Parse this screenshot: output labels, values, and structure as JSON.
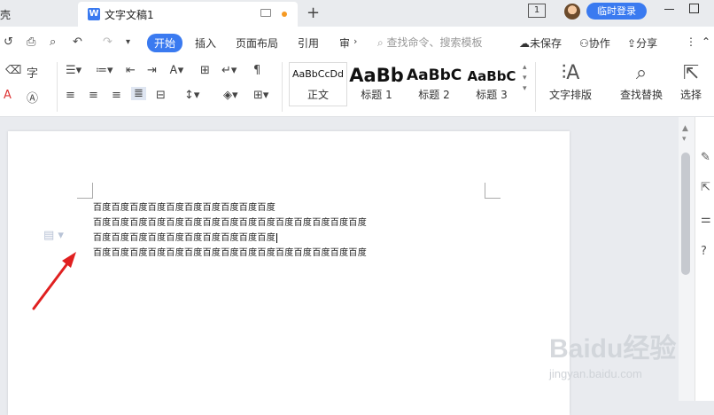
{
  "titlebar": {
    "prev_tab_label": "壳",
    "active_tab_title": "文字文稿1",
    "new_tab": "+",
    "window_count": "1",
    "login_label": "临时登录"
  },
  "ribbon_tabs": {
    "items": [
      "开始",
      "插入",
      "页面布局",
      "引用",
      "审"
    ],
    "search_placeholder": "查找命令、搜索模板",
    "unsaved": "未保存",
    "collaborate": "协作",
    "share": "分享"
  },
  "ribbon": {
    "styles": [
      {
        "preview": "AaBbCcDd",
        "name": "正文"
      },
      {
        "preview": "AaBb",
        "name": "标题 1"
      },
      {
        "preview": "AaBbC",
        "name": "标题 2"
      },
      {
        "preview": "AaBbC",
        "name": "标题 3"
      }
    ],
    "text_layout_label": "文字排版",
    "find_replace_label": "查找替换",
    "select_label": "选择"
  },
  "document": {
    "lines": [
      "百度百度百度百度百度百度百度百度百度百度",
      "百度百度百度百度百度百度百度百度百度百度百度百度百度百度百度",
      "百度百度百度百度百度百度百度百度百度百度",
      "百度百度百度百度百度百度百度百度百度百度百度百度百度百度百度"
    ]
  },
  "watermark": {
    "brand": "Baidu经验",
    "url": "jingyan.baidu.com"
  },
  "colors": {
    "accent": "#3a7af0",
    "arrow": "#e02020"
  }
}
